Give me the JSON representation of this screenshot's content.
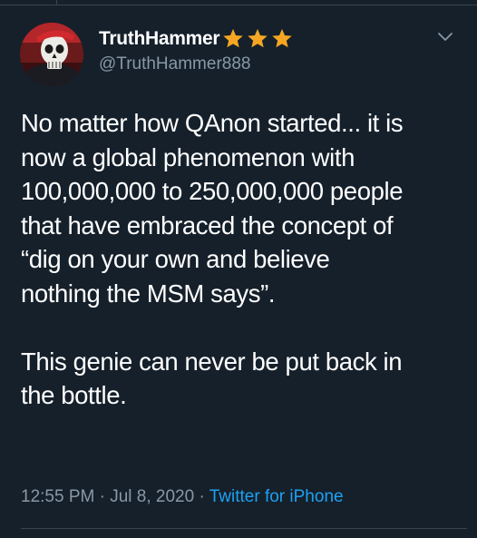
{
  "user": {
    "display_name": "TruthHammer",
    "handle": "@TruthHammer888",
    "badge_icons": [
      "star-icon",
      "star-icon",
      "star-icon"
    ],
    "badge_color": "#f5a623"
  },
  "tweet": {
    "paragraph_1": "No matter how QAnon started... it is\nnow a global phenomenon with\n100,000,000 to 250,000,000 people\nthat have embraced the concept of\n“dig on your own and believe\nnothing the MSM says”.",
    "paragraph_2": "This genie can never be put back in\nthe bottle.",
    "time": "12:55 PM",
    "date": "Jul 8, 2020",
    "separator": "·",
    "source": "Twitter for iPhone"
  },
  "icons": {
    "more_menu": "chevron-down-icon",
    "avatar": "skull-avatar"
  },
  "colors": {
    "background": "#15202b",
    "text_primary": "#ffffff",
    "text_secondary": "#8899a6",
    "link": "#1da1f2",
    "divider": "#38444d"
  }
}
